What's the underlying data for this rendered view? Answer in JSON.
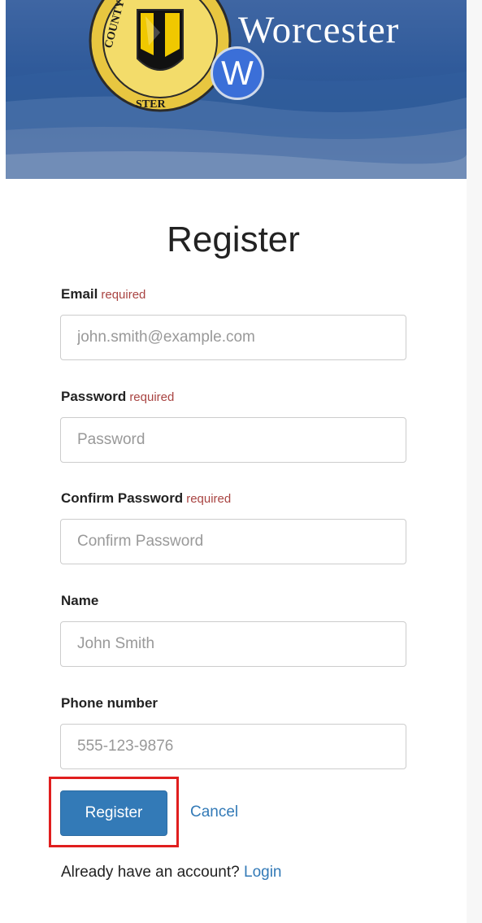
{
  "banner": {
    "title": "Worcester",
    "badge_letter": "W",
    "seal_text_top": "COUNTY WOR",
    "seal_text_bottom": "STER"
  },
  "page": {
    "title": "Register"
  },
  "form": {
    "required_text": "required",
    "email": {
      "label": "Email",
      "placeholder": "john.smith@example.com",
      "value": ""
    },
    "password": {
      "label": "Password",
      "placeholder": "Password",
      "value": ""
    },
    "confirm_password": {
      "label": "Confirm Password",
      "placeholder": "Confirm Password",
      "value": ""
    },
    "name": {
      "label": "Name",
      "placeholder": "John Smith",
      "value": ""
    },
    "phone": {
      "label": "Phone number",
      "placeholder": "555-123-9876",
      "value": ""
    }
  },
  "actions": {
    "register_label": "Register",
    "cancel_label": "Cancel"
  },
  "footer": {
    "prompt": "Already have an account?",
    "login_link": "Login"
  },
  "colors": {
    "primary": "#337ab7",
    "required": "#a94442",
    "highlight": "#e01e1e"
  }
}
